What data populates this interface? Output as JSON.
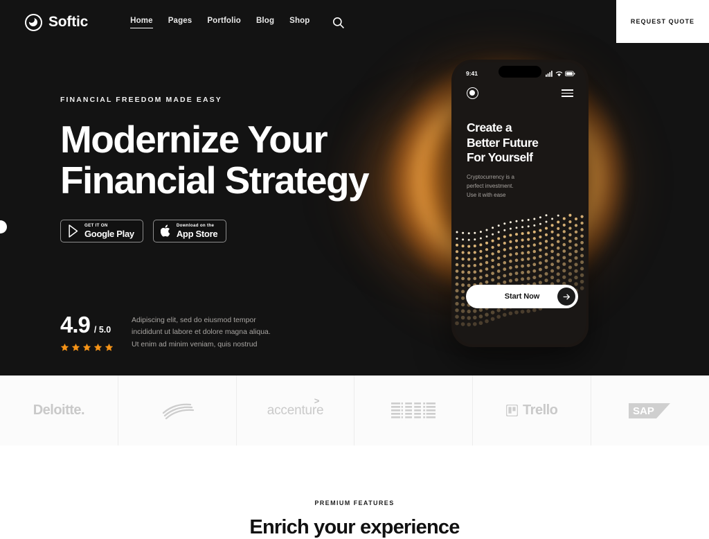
{
  "nav": {
    "brand": "Softic",
    "links": [
      {
        "label": "Home",
        "active": true
      },
      {
        "label": "Pages",
        "active": false
      },
      {
        "label": "Portfolio",
        "active": false
      },
      {
        "label": "Blog",
        "active": false
      },
      {
        "label": "Shop",
        "active": false
      }
    ],
    "search_icon": "search-icon",
    "quote_label": "REQUEST QUOTE"
  },
  "hero": {
    "eyebrow": "FINANCIAL FREEDOM MADE EASY",
    "headline_line1": "Modernize Your",
    "headline_line2": "Financial Strategy",
    "badges": [
      {
        "small": "GET IT ON",
        "big": "Google Play",
        "icon": "google-play-icon"
      },
      {
        "small": "Download on the",
        "big": "App Store",
        "icon": "apple-icon"
      }
    ],
    "rating": {
      "score": "4.9",
      "out_of": "/ 5.0",
      "stars": 5,
      "star_color": "#f59317",
      "text_line1": "Adipiscing elit, sed do eiusmod tempor",
      "text_line2": "incididunt ut labore et dolore magna aliqua.",
      "text_line3": "Ut enim ad minim veniam, quis nostrud"
    },
    "glow_color": "#ff9628"
  },
  "phone": {
    "status_time": "9:41",
    "status_icons": [
      "signal-icon",
      "wifi-icon",
      "battery-icon"
    ],
    "logo_icon": "softic-mark-icon",
    "menu_icon": "hamburger-icon",
    "title_line1": "Create a",
    "title_line2": "Better Future",
    "title_line3": "For Yourself",
    "sub_line1": "Cryptocurrency is a",
    "sub_line2": "perfect investment.",
    "sub_line3": "Use it with ease",
    "cta_label": "Start Now",
    "cta_icon": "arrow-right-icon"
  },
  "logos": [
    {
      "name": "Deloitte.",
      "type": "text"
    },
    {
      "name": "Bank of America",
      "type": "mark"
    },
    {
      "name": "accenture",
      "type": "text"
    },
    {
      "name": "IBM",
      "type": "mark"
    },
    {
      "name": "Trello",
      "type": "text"
    },
    {
      "name": "SAP",
      "type": "mark"
    }
  ],
  "features": {
    "label": "PREMIUM FEATURES",
    "heading": "Enrich your experience"
  }
}
